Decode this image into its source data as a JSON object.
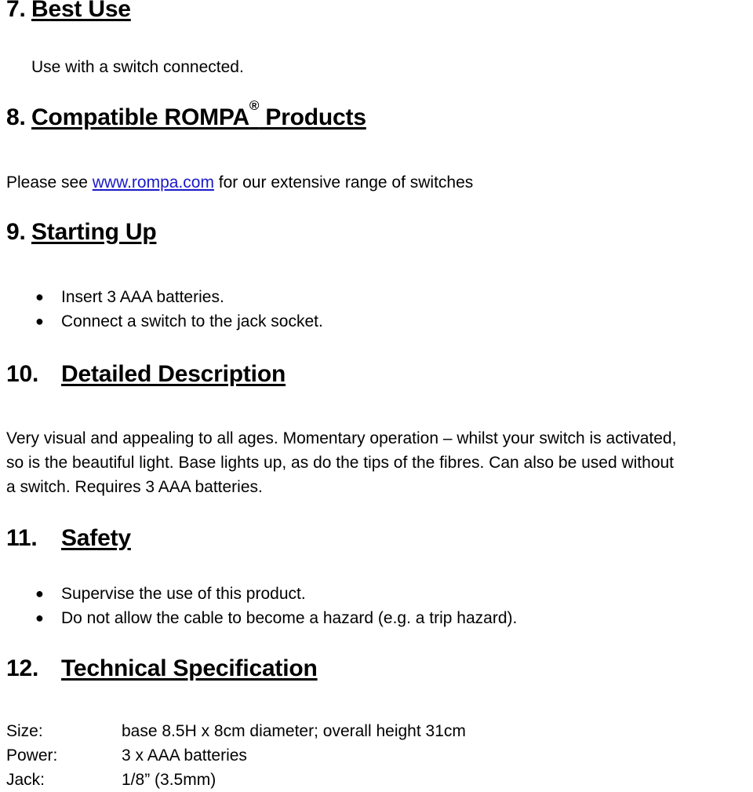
{
  "document": {
    "sections": [
      {
        "number": "7.",
        "title": "Best Use",
        "body_line": "Use with a switch connected."
      },
      {
        "number": "8.",
        "title_before": "Compatible ROMPA",
        "registered_mark": "®",
        "title_after": " Products",
        "intro_before": "Please see ",
        "link_text": "www.rompa.com",
        "intro_after": " for our extensive range of switches"
      },
      {
        "number": "9.",
        "title": "Starting Up",
        "bullets": [
          "Insert 3 AAA batteries.",
          "Connect a switch to the jack socket."
        ]
      },
      {
        "number": "10.",
        "title": "Detailed Description",
        "paragraph_lines": [
          "Very visual and appealing to all ages. Momentary operation – whilst your switch is activated,",
          "so is the beautiful light.  Base lights up, as do the tips of the fibres. Can also be used without",
          "a switch.  Requires 3 AAA batteries."
        ]
      },
      {
        "number": "11.",
        "title": "Safety",
        "bullets": [
          "Supervise the use of this product.",
          "Do not allow the cable to become a hazard (e.g. a trip hazard)."
        ]
      },
      {
        "number": "12.",
        "title": "Technical Specification",
        "spec_rows": [
          {
            "label": "Size:",
            "value": "base 8.5H x 8cm diameter; overall height 31cm"
          },
          {
            "label": "Power:",
            "value": "3 x AAA batteries"
          },
          {
            "label": "Jack:",
            "value": "1/8” (3.5mm)"
          }
        ]
      }
    ],
    "bullet_glyph": "●",
    "link_color": "#1a1ac8",
    "text_color": "#000000",
    "background_color": "#ffffff"
  }
}
